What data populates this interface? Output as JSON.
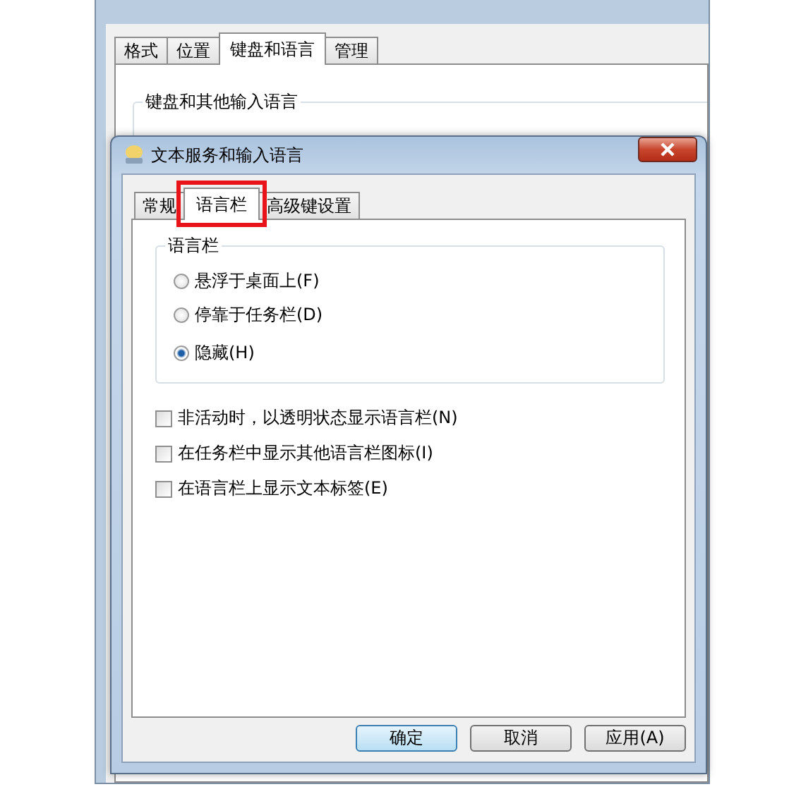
{
  "background_window": {
    "tabs": [
      {
        "label": "格式",
        "selected": false
      },
      {
        "label": "位置",
        "selected": false
      },
      {
        "label": "键盘和语言",
        "selected": true
      },
      {
        "label": "管理",
        "selected": false
      }
    ],
    "group_title": "键盘和其他输入语言"
  },
  "dialog": {
    "title": "文本服务和输入语言",
    "tabs": [
      {
        "label": "常规",
        "selected": false,
        "highlighted": false
      },
      {
        "label": "语言栏",
        "selected": true,
        "highlighted": true
      },
      {
        "label": "高级键设置",
        "selected": false,
        "highlighted": false
      }
    ],
    "group_title": "语言栏",
    "radios": [
      {
        "label": "悬浮于桌面上(F)",
        "selected": false
      },
      {
        "label": "停靠于任务栏(D)",
        "selected": false
      },
      {
        "label": "隐藏(H)",
        "selected": true
      }
    ],
    "checkboxes": [
      {
        "label": "非活动时，以透明状态显示语言栏(N)",
        "checked": false
      },
      {
        "label": "在任务栏中显示其他语言栏图标(I)",
        "checked": false
      },
      {
        "label": "在语言栏上显示文本标签(E)",
        "checked": false
      }
    ],
    "buttons": [
      {
        "label": "确定",
        "default": true
      },
      {
        "label": "取消",
        "default": false
      },
      {
        "label": "应用(A)",
        "default": false
      }
    ]
  }
}
